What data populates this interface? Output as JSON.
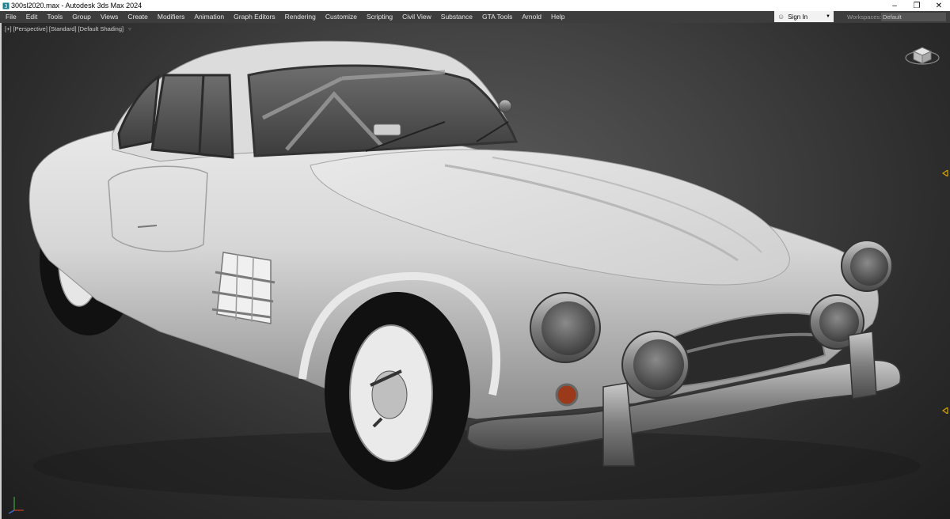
{
  "window": {
    "title": "300sl2020.max - Autodesk 3ds Max 2024",
    "minimize_icon": "minimize-icon",
    "restore_icon": "restore-icon",
    "close_icon": "close-icon"
  },
  "menu": {
    "items": [
      "File",
      "Edit",
      "Tools",
      "Group",
      "Views",
      "Create",
      "Modifiers",
      "Animation",
      "Graph Editors",
      "Rendering",
      "Customize",
      "Scripting",
      "Civil View",
      "Substance",
      "GTA Tools",
      "Arnold",
      "Help"
    ]
  },
  "account": {
    "sign_in_label": "Sign In",
    "workspaces_label": "Workspaces:",
    "workspace_value": "Default"
  },
  "viewport": {
    "labels": [
      "[+]",
      "[Perspective]",
      "[Standard]",
      "[Default Shading]"
    ],
    "filter_icon": "filter-icon",
    "object": "car-model",
    "colors": {
      "body": "#d9d9d9",
      "tire": "#111111",
      "chrome": "#8a8a8a"
    }
  }
}
